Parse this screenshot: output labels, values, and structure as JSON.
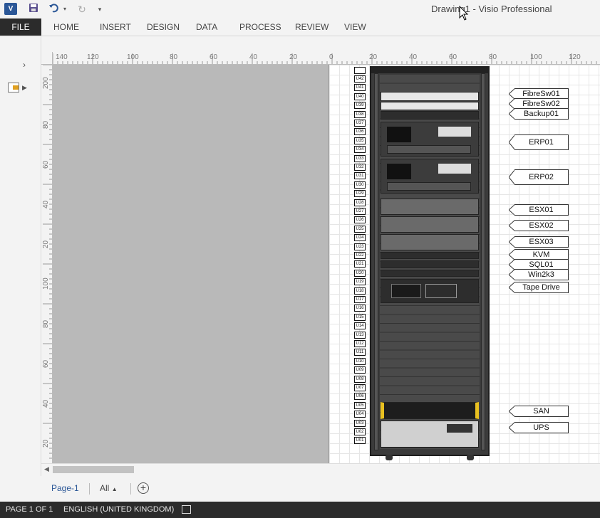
{
  "app": {
    "icon_text": "V",
    "title": "Drawing1 - Visio Professional"
  },
  "qat": {
    "save_icon": "save-icon",
    "undo_icon": "undo-icon",
    "redo_icon": "redo-icon",
    "customize_icon": "customize-qat-icon"
  },
  "ribbon": {
    "tabs": [
      "FILE",
      "HOME",
      "INSERT",
      "DESIGN",
      "DATA",
      "PROCESS",
      "REVIEW",
      "VIEW"
    ]
  },
  "rulers": {
    "horizontal_ticks": [
      "140",
      "120",
      "100",
      "80",
      "60",
      "40",
      "20",
      "0",
      "20",
      "40",
      "60",
      "80",
      "100",
      "120"
    ],
    "vertical_ticks": [
      "200",
      "80",
      "60",
      "40",
      "20",
      "100",
      "80",
      "60",
      "40",
      "20"
    ]
  },
  "rack": {
    "u_labels": [
      "U42",
      "U41",
      "U40",
      "U39",
      "U38",
      "U37",
      "U36",
      "U35",
      "U34",
      "U33",
      "U32",
      "U31",
      "U30",
      "U29",
      "U28",
      "U27",
      "U26",
      "U25",
      "U24",
      "U23",
      "U22",
      "U21",
      "U20",
      "U19",
      "U18",
      "U17",
      "U16",
      "U15",
      "U14",
      "U13",
      "U12",
      "U11",
      "U10",
      "U09",
      "U08",
      "U07",
      "U06",
      "U05",
      "U04",
      "U03",
      "U02",
      "U01"
    ],
    "callouts": [
      "FibreSw01",
      "FibreSw02",
      "Backup01",
      "ERP01",
      "ERP02",
      "ESX01",
      "ESX02",
      "ESX03",
      "KVM",
      "SQL01",
      "Win2k3",
      "Tape Drive",
      "SAN",
      "UPS"
    ]
  },
  "page_tabs": {
    "current": "Page-1",
    "all": "All",
    "add_icon": "add-page-icon"
  },
  "status": {
    "page": "PAGE 1 OF 1",
    "language": "ENGLISH (UNITED KINGDOM)",
    "macro_icon": "macro-record-icon"
  }
}
